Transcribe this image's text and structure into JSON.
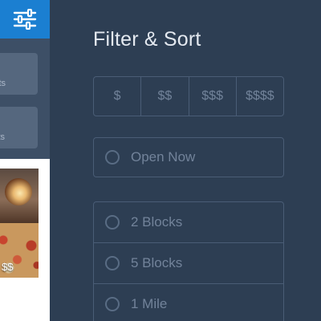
{
  "left_app": {
    "cards": [
      {
        "label": "ts"
      },
      {
        "label": "ts"
      }
    ],
    "photo_card": {
      "price": "$$"
    }
  },
  "filter_panel": {
    "title": "Filter & Sort",
    "price_options": [
      "$",
      "$$",
      "$$$",
      "$$$$"
    ],
    "open_now_label": "Open Now",
    "distance_options": [
      "2 Blocks",
      "5 Blocks",
      "1 Mile"
    ]
  },
  "icons": {
    "filter_toggle": "sliders-icon",
    "radio": "radio-unchecked-icon"
  },
  "colors": {
    "panel_background": "#2d3e53",
    "accent": "#1b7fd1",
    "title_text": "#e4e9f0",
    "muted_text": "#72839a",
    "border": "#4a5d76"
  }
}
